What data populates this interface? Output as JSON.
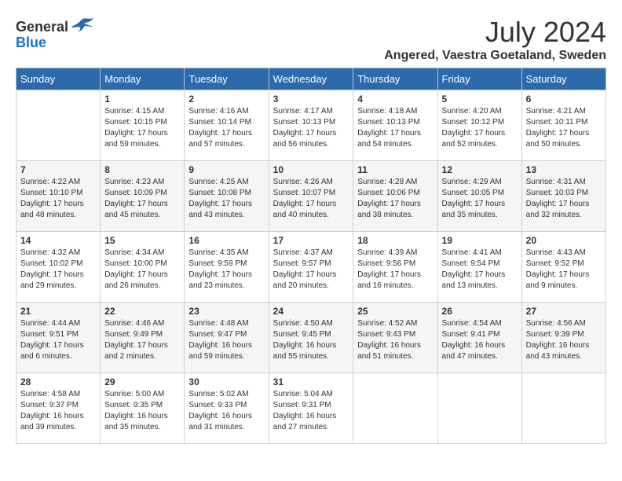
{
  "header": {
    "logo_general": "General",
    "logo_blue": "Blue",
    "month_year": "July 2024",
    "location": "Angered, Vaestra Goetaland, Sweden"
  },
  "calendar": {
    "days_of_week": [
      "Sunday",
      "Monday",
      "Tuesday",
      "Wednesday",
      "Thursday",
      "Friday",
      "Saturday"
    ],
    "weeks": [
      [
        {
          "day": "",
          "info": ""
        },
        {
          "day": "1",
          "info": "Sunrise: 4:15 AM\nSunset: 10:15 PM\nDaylight: 17 hours\nand 59 minutes."
        },
        {
          "day": "2",
          "info": "Sunrise: 4:16 AM\nSunset: 10:14 PM\nDaylight: 17 hours\nand 57 minutes."
        },
        {
          "day": "3",
          "info": "Sunrise: 4:17 AM\nSunset: 10:13 PM\nDaylight: 17 hours\nand 56 minutes."
        },
        {
          "day": "4",
          "info": "Sunrise: 4:18 AM\nSunset: 10:13 PM\nDaylight: 17 hours\nand 54 minutes."
        },
        {
          "day": "5",
          "info": "Sunrise: 4:20 AM\nSunset: 10:12 PM\nDaylight: 17 hours\nand 52 minutes."
        },
        {
          "day": "6",
          "info": "Sunrise: 4:21 AM\nSunset: 10:11 PM\nDaylight: 17 hours\nand 50 minutes."
        }
      ],
      [
        {
          "day": "7",
          "info": "Sunrise: 4:22 AM\nSunset: 10:10 PM\nDaylight: 17 hours\nand 48 minutes."
        },
        {
          "day": "8",
          "info": "Sunrise: 4:23 AM\nSunset: 10:09 PM\nDaylight: 17 hours\nand 45 minutes."
        },
        {
          "day": "9",
          "info": "Sunrise: 4:25 AM\nSunset: 10:08 PM\nDaylight: 17 hours\nand 43 minutes."
        },
        {
          "day": "10",
          "info": "Sunrise: 4:26 AM\nSunset: 10:07 PM\nDaylight: 17 hours\nand 40 minutes."
        },
        {
          "day": "11",
          "info": "Sunrise: 4:28 AM\nSunset: 10:06 PM\nDaylight: 17 hours\nand 38 minutes."
        },
        {
          "day": "12",
          "info": "Sunrise: 4:29 AM\nSunset: 10:05 PM\nDaylight: 17 hours\nand 35 minutes."
        },
        {
          "day": "13",
          "info": "Sunrise: 4:31 AM\nSunset: 10:03 PM\nDaylight: 17 hours\nand 32 minutes."
        }
      ],
      [
        {
          "day": "14",
          "info": "Sunrise: 4:32 AM\nSunset: 10:02 PM\nDaylight: 17 hours\nand 29 minutes."
        },
        {
          "day": "15",
          "info": "Sunrise: 4:34 AM\nSunset: 10:00 PM\nDaylight: 17 hours\nand 26 minutes."
        },
        {
          "day": "16",
          "info": "Sunrise: 4:35 AM\nSunset: 9:59 PM\nDaylight: 17 hours\nand 23 minutes."
        },
        {
          "day": "17",
          "info": "Sunrise: 4:37 AM\nSunset: 9:57 PM\nDaylight: 17 hours\nand 20 minutes."
        },
        {
          "day": "18",
          "info": "Sunrise: 4:39 AM\nSunset: 9:56 PM\nDaylight: 17 hours\nand 16 minutes."
        },
        {
          "day": "19",
          "info": "Sunrise: 4:41 AM\nSunset: 9:54 PM\nDaylight: 17 hours\nand 13 minutes."
        },
        {
          "day": "20",
          "info": "Sunrise: 4:43 AM\nSunset: 9:52 PM\nDaylight: 17 hours\nand 9 minutes."
        }
      ],
      [
        {
          "day": "21",
          "info": "Sunrise: 4:44 AM\nSunset: 9:51 PM\nDaylight: 17 hours\nand 6 minutes."
        },
        {
          "day": "22",
          "info": "Sunrise: 4:46 AM\nSunset: 9:49 PM\nDaylight: 17 hours\nand 2 minutes."
        },
        {
          "day": "23",
          "info": "Sunrise: 4:48 AM\nSunset: 9:47 PM\nDaylight: 16 hours\nand 59 minutes."
        },
        {
          "day": "24",
          "info": "Sunrise: 4:50 AM\nSunset: 9:45 PM\nDaylight: 16 hours\nand 55 minutes."
        },
        {
          "day": "25",
          "info": "Sunrise: 4:52 AM\nSunset: 9:43 PM\nDaylight: 16 hours\nand 51 minutes."
        },
        {
          "day": "26",
          "info": "Sunrise: 4:54 AM\nSunset: 9:41 PM\nDaylight: 16 hours\nand 47 minutes."
        },
        {
          "day": "27",
          "info": "Sunrise: 4:56 AM\nSunset: 9:39 PM\nDaylight: 16 hours\nand 43 minutes."
        }
      ],
      [
        {
          "day": "28",
          "info": "Sunrise: 4:58 AM\nSunset: 9:37 PM\nDaylight: 16 hours\nand 39 minutes."
        },
        {
          "day": "29",
          "info": "Sunrise: 5:00 AM\nSunset: 9:35 PM\nDaylight: 16 hours\nand 35 minutes."
        },
        {
          "day": "30",
          "info": "Sunrise: 5:02 AM\nSunset: 9:33 PM\nDaylight: 16 hours\nand 31 minutes."
        },
        {
          "day": "31",
          "info": "Sunrise: 5:04 AM\nSunset: 9:31 PM\nDaylight: 16 hours\nand 27 minutes."
        },
        {
          "day": "",
          "info": ""
        },
        {
          "day": "",
          "info": ""
        },
        {
          "day": "",
          "info": ""
        }
      ]
    ]
  }
}
